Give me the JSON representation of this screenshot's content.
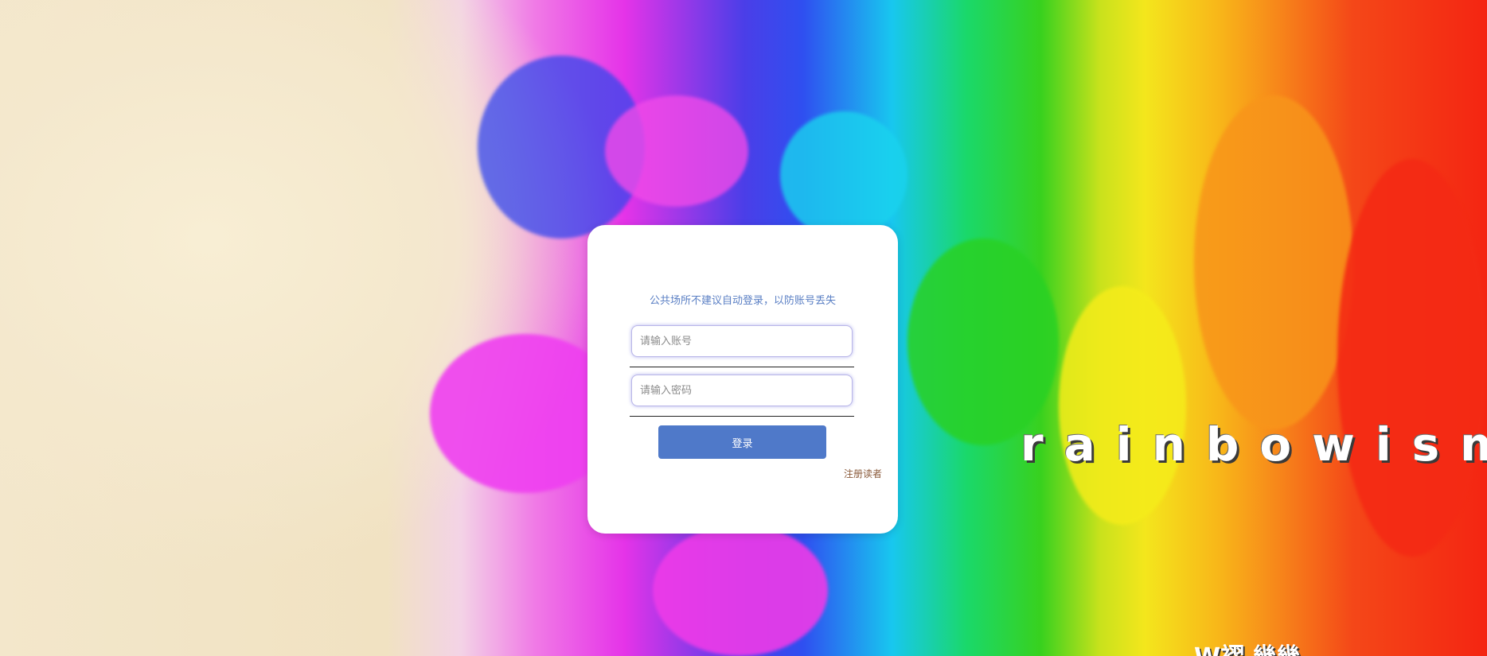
{
  "login": {
    "notice": "公共场所不建议自动登录，以防账号丢失",
    "account_placeholder": "请输入账号",
    "password_placeholder": "请输入密码",
    "login_label": "登录",
    "register_label": "注册读者"
  },
  "background": {
    "brand": "rainbowism",
    "bottom_text": "W褶 幾幾"
  },
  "colors": {
    "button": "#4f79c9",
    "notice": "#5a7fc4",
    "register_link": "#8a5a3a",
    "input_glow": "#5a5adc"
  }
}
